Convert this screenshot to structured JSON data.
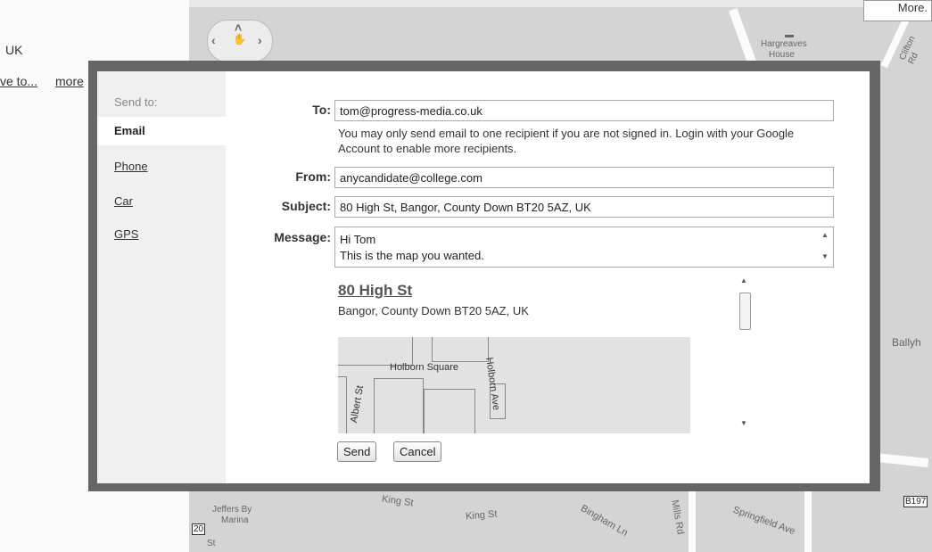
{
  "background": {
    "location_fragment": "UK",
    "link_fragment_1": "ve to...",
    "link_fragment_2": "more",
    "more_button": "More.",
    "map_labels": {
      "hargreaves_1": "Hargreaves",
      "hargreaves_2": "House",
      "clifton": "Clifton Rd",
      "ballyh": "Ballyh",
      "jeffers_1": "Jeffers By",
      "jeffers_2": "Marina",
      "king1": "King St",
      "king2": "King St",
      "bingham": "Bingham Ln",
      "mills": "Mills Rd",
      "springfield": "Springfield Ave",
      "road_badge": "B197",
      "num20": "20",
      "st": "St"
    }
  },
  "dialog": {
    "sidebar": {
      "title": "Send to:",
      "items": [
        "Email",
        "Phone",
        "Car",
        "GPS"
      ],
      "active": "Email"
    },
    "form": {
      "to_label": "To:",
      "to_value": "tom@progress-media.co.uk",
      "note": "You may only send email to one recipient if you are not signed in. Login with your Google Account to enable more recipients.",
      "from_label": "From:",
      "from_value": "anycandidate@college.com",
      "subject_label": "Subject:",
      "subject_value": "80 High St, Bangor, County Down BT20 5AZ, UK",
      "message_label": "Message:",
      "message_line_1": "Hi Tom",
      "message_line_2": "This is the map you wanted."
    },
    "preview": {
      "title": "80 High St",
      "address": "Bangor, County Down BT20 5AZ, UK",
      "streets": {
        "holborn_square": "Holborn Square",
        "holborn_ave": "Holborn Ave",
        "albert_st": "Albert St"
      }
    },
    "buttons": {
      "send": "Send",
      "cancel": "Cancel"
    }
  }
}
